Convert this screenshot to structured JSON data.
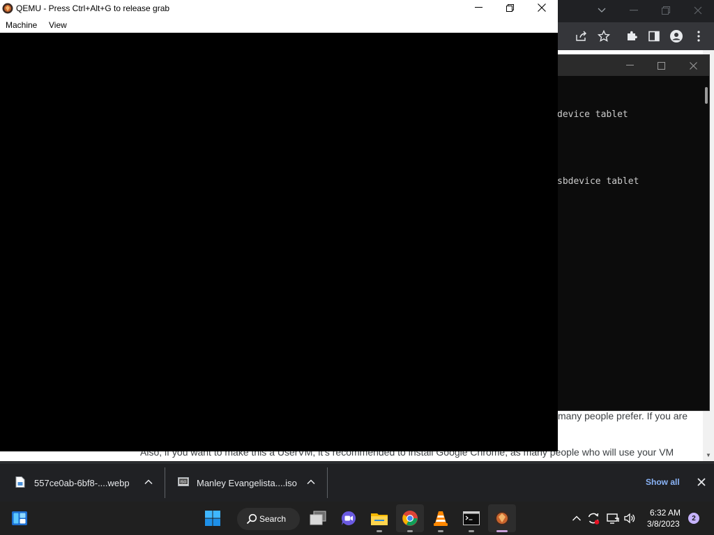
{
  "qemu": {
    "title": "QEMU - Press Ctrl+Alt+G to release grab",
    "menu": [
      "Machine",
      "View"
    ]
  },
  "terminal": {
    "lines": [
      "device tablet",
      "sbdevice tablet"
    ]
  },
  "browser_page": {
    "line1": "many people prefer. If you are",
    "line2": "Also, if you want to make this a UserVM, it's recommended to install Google Chrome, as many people who will use your VM"
  },
  "downloads": {
    "items": [
      {
        "name": "557ce0ab-6bf8-....webp",
        "icon": "image-file-icon"
      },
      {
        "name": "Manley Evangelista....iso",
        "icon": "iso-file-icon"
      }
    ],
    "show_all": "Show all"
  },
  "taskbar": {
    "search_label": "Search",
    "apps": [
      "task-view",
      "teams-chat",
      "file-explorer",
      "chrome",
      "vlc",
      "terminal",
      "qemu"
    ]
  },
  "tray": {
    "time": "6:32 AM",
    "date": "3/8/2023",
    "notifications": "2"
  },
  "colors": {
    "taskbar_bg": "#202020",
    "download_bar_bg": "#202124",
    "show_all_link": "#8ab4f8",
    "badge": "#c6b3ff"
  }
}
